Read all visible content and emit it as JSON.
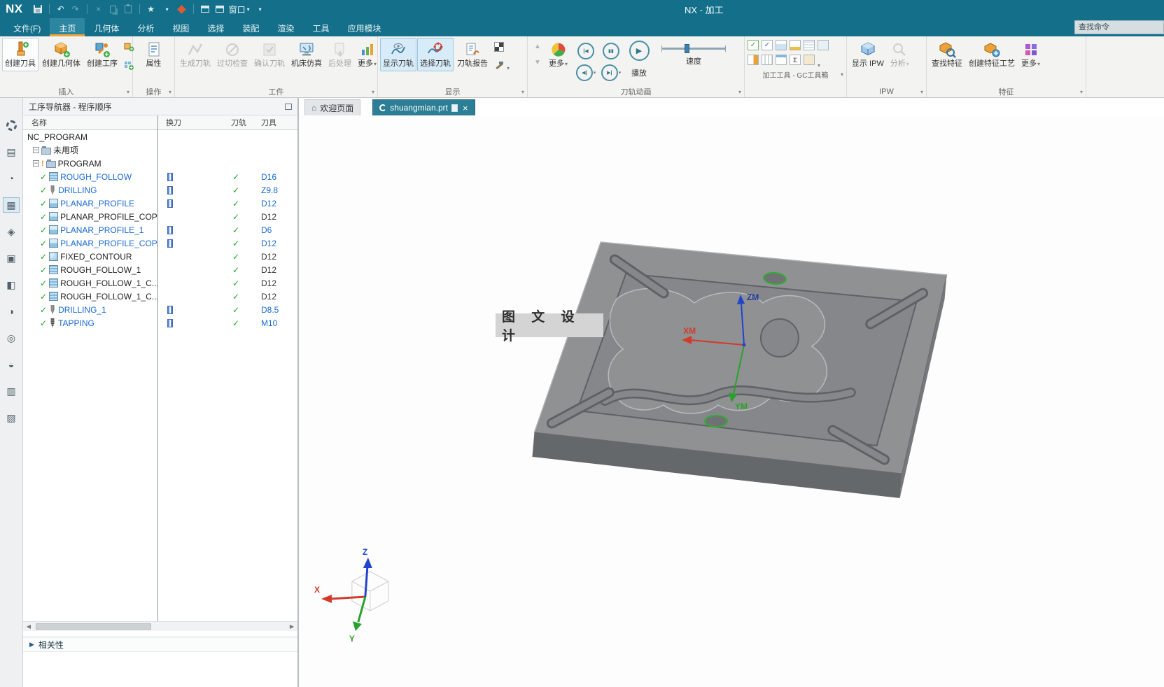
{
  "titlebar": {
    "logo": "NX",
    "title": "NX - 加工",
    "window_label": "窗口"
  },
  "menubar": {
    "tabs": [
      "文件(F)",
      "主页",
      "几何体",
      "分析",
      "视图",
      "选择",
      "装配",
      "渲染",
      "工具",
      "应用模块"
    ],
    "search_placeholder": "查找命令"
  },
  "ribbon": {
    "insert": {
      "label": "插入",
      "create_tool": "创建刀具",
      "create_geometry": "创建几何体",
      "create_operation": "创建工序"
    },
    "operations": {
      "label": "操作",
      "properties": "属性"
    },
    "workpiece": {
      "label": "工件",
      "generate_toolpath": "生成刀轨",
      "gouge_check": "过切检查",
      "verify_toolpath": "确认刀轨",
      "machine_simulation": "机床仿真",
      "postprocess": "后处理",
      "more": "更多"
    },
    "display": {
      "label": "显示",
      "show_toolpath": "显示刀轨",
      "select_toolpath": "选择刀轨",
      "toolpath_report": "刀轨报告"
    },
    "animation": {
      "label": "刀轨动画",
      "more": "更多",
      "play": "播放",
      "speed": "速度"
    },
    "gc_toolbox": {
      "label": "加工工具 - GC工具箱"
    },
    "ipw": {
      "label": "IPW",
      "show_ipw": "显示 IPW",
      "analysis": "分析"
    },
    "feature": {
      "label": "特征",
      "find_feature": "查找特征",
      "create_feature_process": "创建特征工艺",
      "more": "更多"
    }
  },
  "navigator": {
    "title": "工序导航器 - 程序顺序",
    "columns": {
      "name": "名称",
      "tool_change": "换刀",
      "toolpath": "刀轨",
      "tool": "刀具"
    },
    "rows": [
      {
        "name": "NC_PROGRAM",
        "tool": ""
      },
      {
        "name": "未用项",
        "tool": ""
      },
      {
        "name": "PROGRAM",
        "tool": ""
      },
      {
        "name": "ROUGH_FOLLOW",
        "tool": "D16"
      },
      {
        "name": "DRILLING",
        "tool": "Z9.8"
      },
      {
        "name": "PLANAR_PROFILE",
        "tool": "D12"
      },
      {
        "name": "PLANAR_PROFILE_COPY",
        "tool": "D12"
      },
      {
        "name": "PLANAR_PROFILE_1",
        "tool": "D6"
      },
      {
        "name": "PLANAR_PROFILE_COP...",
        "tool": "D12"
      },
      {
        "name": "FIXED_CONTOUR",
        "tool": "D12"
      },
      {
        "name": "ROUGH_FOLLOW_1",
        "tool": "D12"
      },
      {
        "name": "ROUGH_FOLLOW_1_C...",
        "tool": "D12"
      },
      {
        "name": "ROUGH_FOLLOW_1_C...",
        "tool": "D12"
      },
      {
        "name": "DRILLING_1",
        "tool": "D8.5"
      },
      {
        "name": "TAPPING",
        "tool": "M10"
      }
    ],
    "footer": "相关性"
  },
  "viewport": {
    "tabs": {
      "welcome": "欢迎页面",
      "part": "shuangmian.prt"
    },
    "watermark": "图 文 设 计",
    "wcs": {
      "x": "XM",
      "y": "YM",
      "z": "ZM"
    },
    "triad": {
      "x": "X",
      "y": "Y",
      "z": "Z"
    }
  },
  "colors": {
    "titlebar": "#14708a",
    "active_tab_underline": "#f0a23c",
    "selected_text": "#1a6ad4",
    "check_green": "#1fa51f",
    "hole_green": "#2fae33"
  },
  "icons": {
    "check": "✓",
    "caret_down": "▾",
    "close": "×",
    "minus": "−",
    "marker": "!",
    "home": "⌂",
    "undo": "↶",
    "redo": "↷",
    "star": "★",
    "cut": "×",
    "up": "▲",
    "down": "▼",
    "to_start": "|◀",
    "pause": "▮▮",
    "play": "▶",
    "step_back": "◀|",
    "step_fwd": "▶|",
    "left": "◀",
    "right": "▶",
    "tri_right": "▶",
    "rb_assembly": "▤",
    "rb_constraint": "◔",
    "rb_opnav": "▦",
    "rb_feature": "◈",
    "rb_part": "▣",
    "rb_reuse": "◧",
    "rb_view": "◑",
    "rb_web": "◎",
    "rb_history": "◒",
    "rb_tools": "▥",
    "rb_layers": "▨"
  }
}
